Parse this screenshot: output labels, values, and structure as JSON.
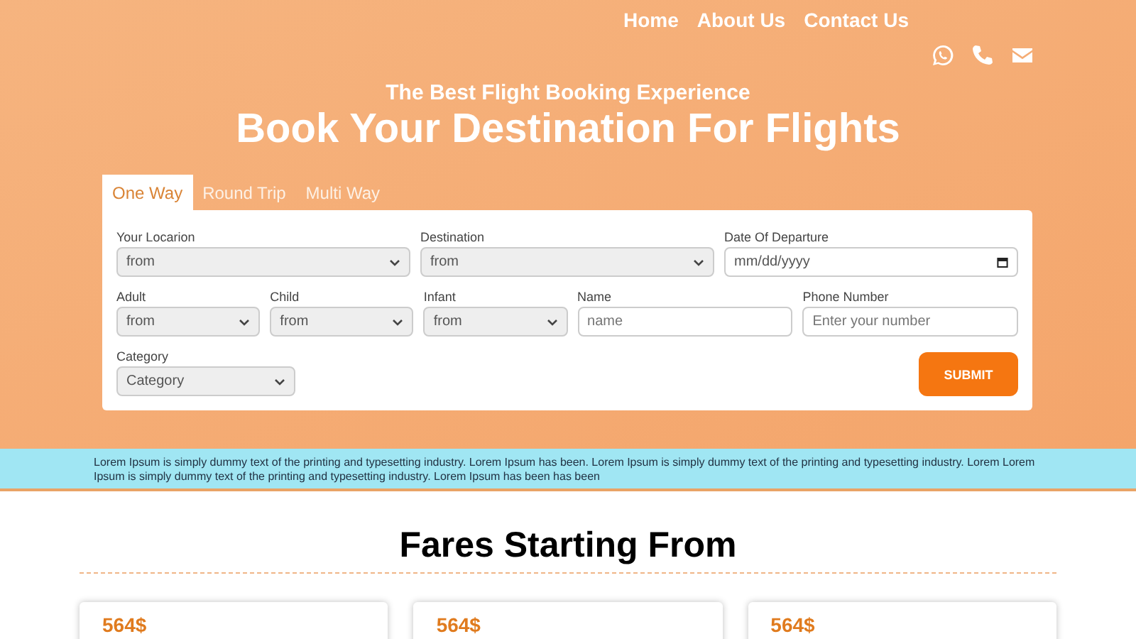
{
  "nav": {
    "links": [
      "Home",
      "About Us",
      "Contact Us"
    ]
  },
  "hero": {
    "subtitle": "The Best Flight Booking Experience",
    "title": "Book Your Destination For Flights"
  },
  "tabs": [
    {
      "label": "One Way",
      "selected": true
    },
    {
      "label": "Round Trip",
      "selected": false
    },
    {
      "label": "Multi Way",
      "selected": false
    }
  ],
  "form": {
    "fields": [
      {
        "label": "Your Locarion",
        "kind": "select",
        "value": "from"
      },
      {
        "label": "Destination",
        "kind": "select",
        "value": "from"
      },
      {
        "label": "Date Of Departure",
        "kind": "date",
        "placeholder": "mm/dd/yyyy"
      },
      {
        "label": "Adult",
        "kind": "select",
        "value": "from"
      },
      {
        "label": "Child",
        "kind": "select",
        "value": "from"
      },
      {
        "label": "Infant",
        "kind": "select",
        "value": "from"
      },
      {
        "label": "Name",
        "kind": "text",
        "placeholder": "name"
      },
      {
        "label": "Phone Number",
        "kind": "text",
        "placeholder": "Enter your number"
      }
    ],
    "category": {
      "label": "Category",
      "value": "Category"
    },
    "submit": "SUBMIT"
  },
  "notice": "Lorem Ipsum is simply dummy text of the printing and typesetting industry. Lorem Ipsum has been. Lorem Ipsum is simply dummy text of the printing and typesetting industry. Lorem Lorem Ipsum is simply dummy text of the printing and typesetting industry. Lorem Ipsum has been has been",
  "fares": {
    "title": "Fares Starting From",
    "cards": [
      {
        "price": "564$"
      },
      {
        "price": "564$"
      },
      {
        "price": "564$"
      }
    ]
  }
}
